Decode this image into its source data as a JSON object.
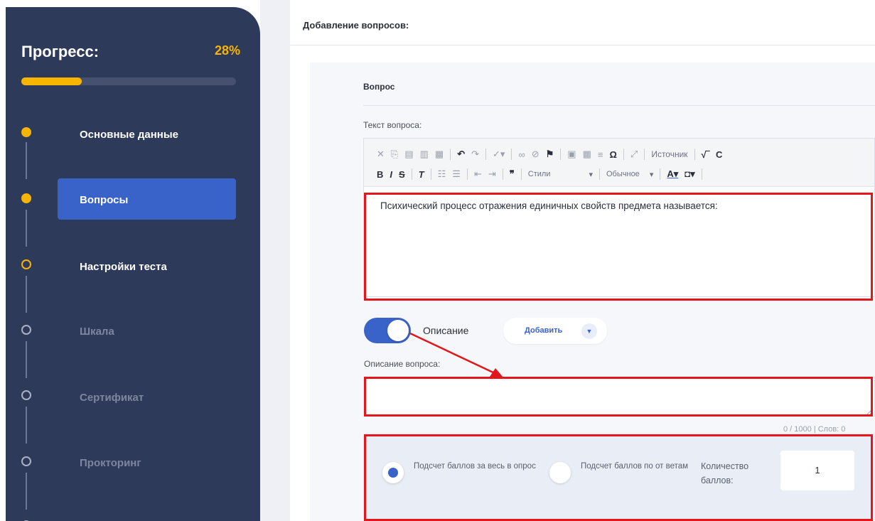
{
  "sidebar": {
    "title": "Прогресс:",
    "percent_label": "28%",
    "progress": 0.28,
    "steps": [
      {
        "label": "Основные данные",
        "state": "done"
      },
      {
        "label": "Вопросы",
        "state": "active"
      },
      {
        "label": "Настройки теста",
        "state": "current"
      },
      {
        "label": "Шкала",
        "state": "pending"
      },
      {
        "label": "Сертификат",
        "state": "pending"
      },
      {
        "label": "Прокторинг",
        "state": "pending"
      }
    ]
  },
  "header": {
    "title": "Добавление вопросов:"
  },
  "question": {
    "section_title": "Вопрос",
    "text_label": "Текст вопроса:",
    "toolbar": {
      "source_label": "Источник",
      "styles_label": "Стили",
      "format_label": "Обычное"
    },
    "text": "Психический процесс отражения единичных свойств предмета называется:",
    "description_toggle": {
      "label": "Описание",
      "on": true
    },
    "add_button_label": "Добавить",
    "description_label": "Описание вопроса:",
    "description_value": "",
    "counter": "0 / 1000 | Слов: 0"
  },
  "scoring": {
    "option_whole": "Подсчет баллов за весь в опрос",
    "option_answers": "Подсчет баллов по от ветам",
    "points_label": "Количество баллов:",
    "points_value": "1",
    "selected": "option_whole"
  },
  "colors": {
    "sidebar_bg": "#2e3a59",
    "accent_yellow": "#f7b500",
    "accent_blue": "#3a63c9",
    "highlight_red": "#e3161b"
  }
}
